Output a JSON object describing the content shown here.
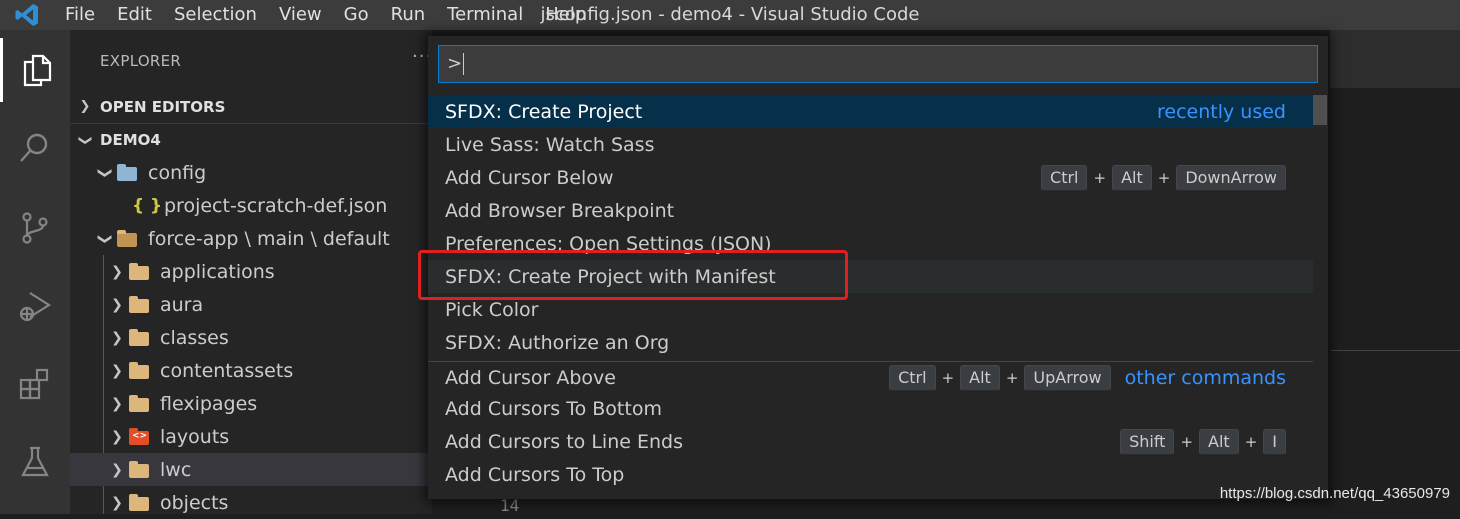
{
  "window": {
    "title": "jsconfig.json - demo4 - Visual Studio Code"
  },
  "menu": [
    "File",
    "Edit",
    "Selection",
    "View",
    "Go",
    "Run",
    "Terminal",
    "Help"
  ],
  "activity_icons": [
    "files-icon",
    "search-icon",
    "source-control-icon",
    "run-debug-icon",
    "extensions-icon",
    "testing-icon"
  ],
  "explorer": {
    "title": "EXPLORER",
    "more": "···",
    "open_editors": "OPEN EDITORS",
    "workspace": "DEMO4",
    "tree": [
      {
        "label": "config",
        "depth": 1,
        "kind": "folder-config",
        "expanded": true
      },
      {
        "label": "project-scratch-def.json",
        "depth": 2,
        "kind": "json"
      },
      {
        "label": "force-app \\ main \\ default",
        "depth": 1,
        "kind": "folder-open",
        "expanded": true
      },
      {
        "label": "applications",
        "depth": 2,
        "kind": "folder"
      },
      {
        "label": "aura",
        "depth": 2,
        "kind": "folder"
      },
      {
        "label": "classes",
        "depth": 2,
        "kind": "folder"
      },
      {
        "label": "contentassets",
        "depth": 2,
        "kind": "folder"
      },
      {
        "label": "flexipages",
        "depth": 2,
        "kind": "folder"
      },
      {
        "label": "layouts",
        "depth": 2,
        "kind": "folder-layout"
      },
      {
        "label": "lwc",
        "depth": 2,
        "kind": "folder",
        "selected": true
      },
      {
        "label": "objects",
        "depth": 2,
        "kind": "folder"
      }
    ]
  },
  "palette": {
    "input_value": ">",
    "commands": [
      {
        "label": "SFDX: Create Project",
        "selected": true,
        "hint": "recently used"
      },
      {
        "label": "Live Sass: Watch Sass"
      },
      {
        "label": "Add Cursor Below",
        "keys": [
          "Ctrl",
          "Alt",
          "DownArrow"
        ]
      },
      {
        "label": "Add Browser Breakpoint"
      },
      {
        "label": "Preferences: Open Settings (JSON)"
      },
      {
        "label": "SFDX: Create Project with Manifest",
        "hovered": true
      },
      {
        "label": "Pick Color"
      },
      {
        "label": "SFDX: Authorize an Org"
      },
      {
        "label": "Add Cursor Above",
        "keys": [
          "Ctrl",
          "Alt",
          "UpArrow"
        ],
        "hint": "other commands",
        "separator": true
      },
      {
        "label": "Add Cursors To Bottom"
      },
      {
        "label": "Add Cursors to Line Ends",
        "keys": [
          "Shift",
          "Alt",
          "I"
        ]
      },
      {
        "label": "Add Cursors To Top"
      }
    ]
  },
  "editor": {
    "visible_line_number": "14"
  },
  "watermark": "https://blog.csdn.net/qq_43650979",
  "colors": {
    "accent": "#007fd4",
    "selection": "#062f4a",
    "hint": "#3794ff",
    "annotation": "#e02020"
  }
}
